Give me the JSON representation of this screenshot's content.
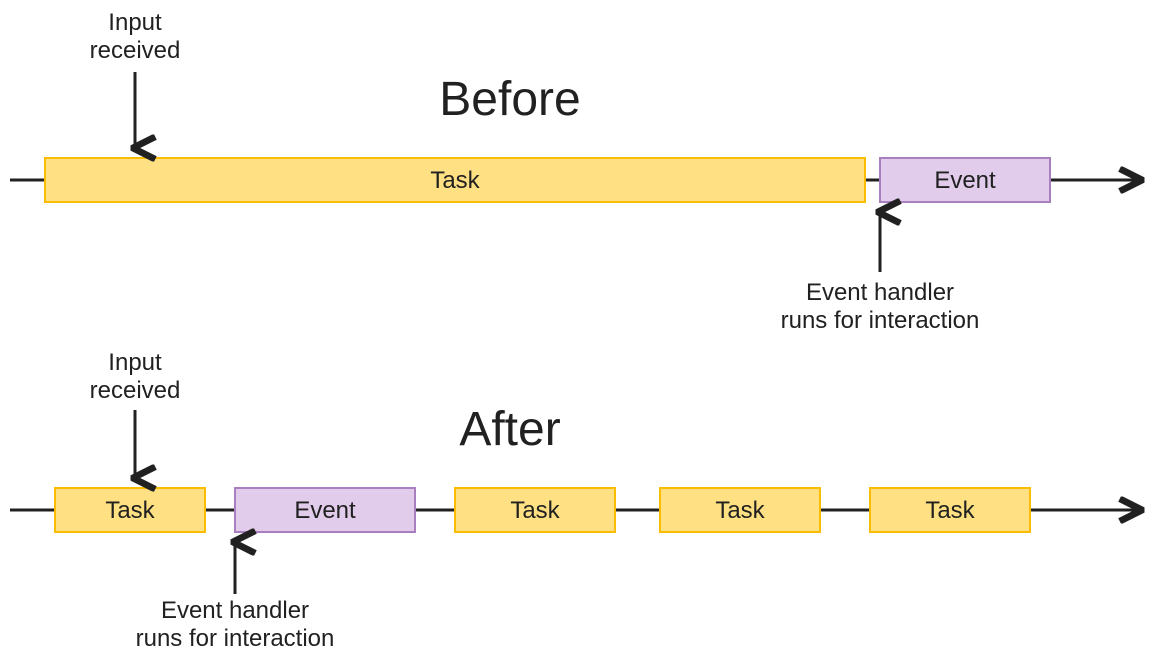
{
  "before": {
    "title": "Before",
    "input_label_l1": "Input",
    "input_label_l2": "received",
    "handler_label_l1": "Event handler",
    "handler_label_l2": "runs for interaction",
    "task_label": "Task",
    "event_label": "Event"
  },
  "after": {
    "title": "After",
    "input_label_l1": "Input",
    "input_label_l2": "received",
    "handler_label_l1": "Event handler",
    "handler_label_l2": "runs for interaction",
    "task1": "Task",
    "event": "Event",
    "task2": "Task",
    "task3": "Task",
    "task4": "Task"
  }
}
